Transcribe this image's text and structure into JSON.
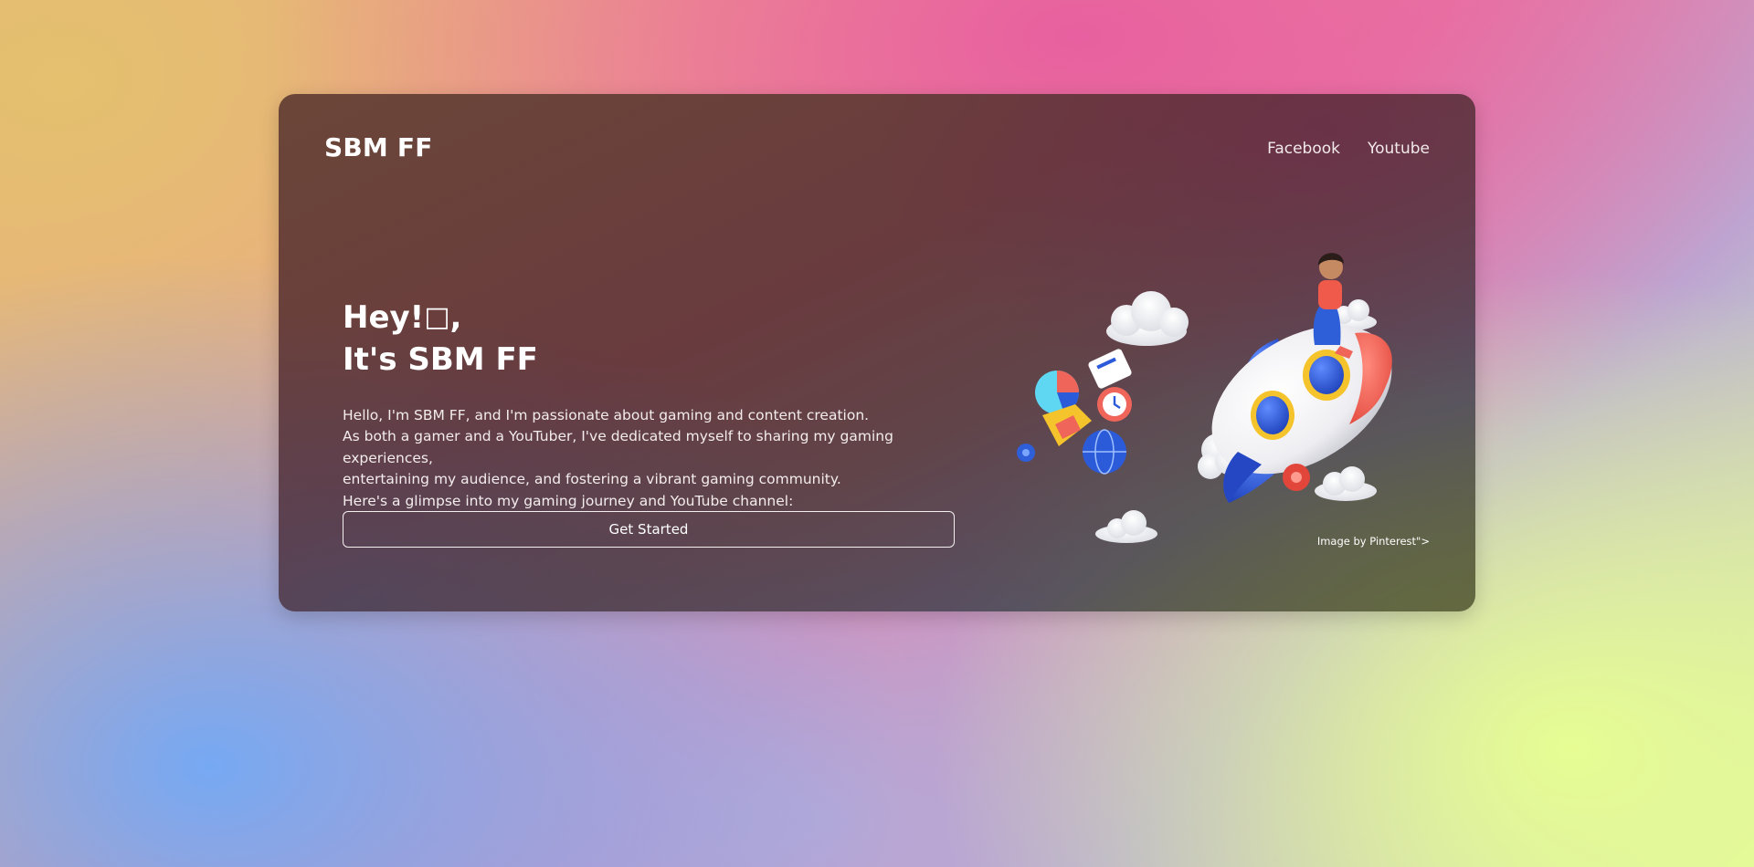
{
  "header": {
    "logo": "SBM FF",
    "nav": [
      {
        "label": "Facebook"
      },
      {
        "label": "Youtube"
      }
    ]
  },
  "hero": {
    "title_line1": "Hey!",
    "title_glyph": "□",
    "title_comma": ",",
    "title_line2": "It's SBM FF",
    "description": [
      "Hello, I'm SBM FF, and I'm passionate about gaming and content creation.",
      "As both a gamer and a YouTuber, I've dedicated myself to sharing my gaming experiences,",
      "entertaining my audience, and fostering a vibrant gaming community.",
      "Here's a glimpse into my gaming journey and YouTube channel:"
    ],
    "cta_label": "Get Started"
  },
  "illustration": {
    "subject": "rocket-illustration",
    "credit": "Image by Pinterest\">"
  },
  "colors": {
    "rocket_body": "#f4f4f6",
    "rocket_fin": "#2b5bd9",
    "rocket_nose": "#f0655a",
    "window_ring": "#f5c32b"
  }
}
